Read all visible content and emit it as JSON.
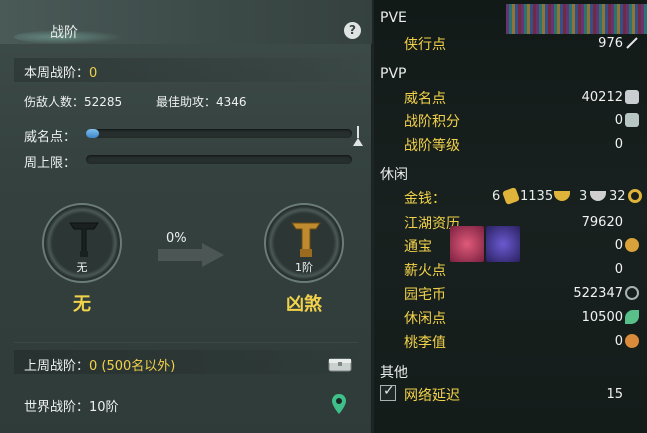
{
  "left_panel": {
    "title": "战阶",
    "help_glyph": "?",
    "weekly_rank_label": "本周战阶：",
    "weekly_rank_value": "0",
    "kills_label": "伤敌人数：",
    "kills_value": "52285",
    "best_assist_label": "最佳助攻：",
    "best_assist_value": "4346",
    "prestige_label": "威名点：",
    "prestige_progress": 0.05,
    "weekly_cap_label": "周上限：",
    "weekly_cap_progress": 0,
    "current_medal": {
      "level_label": "无",
      "name": "无"
    },
    "progress_percent": "0%",
    "next_medal": {
      "level_label": "1阶",
      "name": "凶煞"
    },
    "last_rank_label": "上周战阶：",
    "last_rank_value": "0 (500名以外)",
    "world_rank_label": "世界战阶：",
    "world_rank_value": "10阶",
    "accent_color": "#f2d24a"
  },
  "right_panel": {
    "pve": {
      "header": "PVE",
      "items": [
        {
          "label": "侠行点",
          "value": "976",
          "icon": "pen-icon"
        }
      ]
    },
    "pvp": {
      "header": "PVP",
      "items": [
        {
          "label": "威名点",
          "value": "40212",
          "icon": "prestige-icon"
        },
        {
          "label": "战阶积分",
          "value": "0",
          "icon": "rank-points-icon"
        },
        {
          "label": "战阶等级",
          "value": "0",
          "icon": ""
        }
      ]
    },
    "leisure": {
      "header": "休闲",
      "money_label": "金钱：",
      "money_gold": "6",
      "money_silver": "1135",
      "money_copper": "3",
      "money_other": "32",
      "items": [
        {
          "label": "江湖资历",
          "value": "79620",
          "icon": ""
        },
        {
          "label": "通宝",
          "value": "0",
          "icon": "coin-icon"
        },
        {
          "label": "薪火点",
          "value": "0",
          "icon": ""
        },
        {
          "label": "园宅币",
          "value": "522347",
          "icon": "spiral-icon"
        },
        {
          "label": "休闲点",
          "value": "10500",
          "icon": "leaf-icon"
        },
        {
          "label": "桃李值",
          "value": "0",
          "icon": "gourd-icon"
        }
      ]
    },
    "other": {
      "header": "其他",
      "items": [
        {
          "label": "网络延迟",
          "value": "15",
          "checked": true
        }
      ]
    }
  }
}
